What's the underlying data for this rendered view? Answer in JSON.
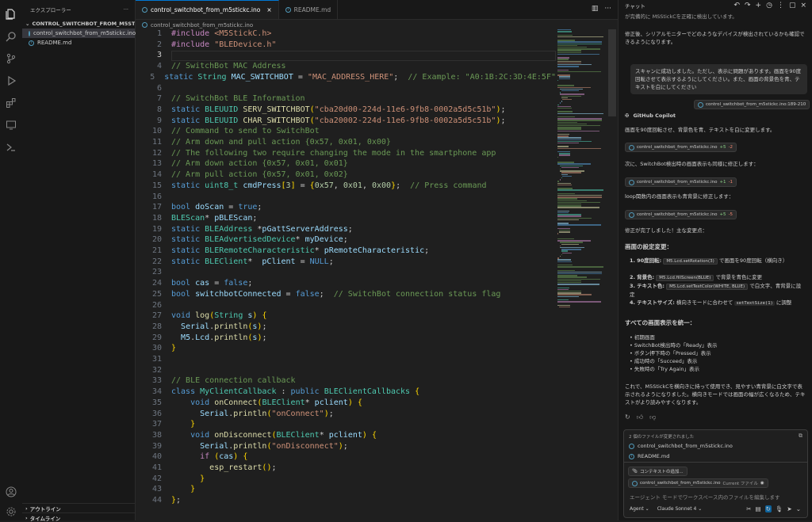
{
  "explorer": {
    "title": "エクスプローラー",
    "folder": "CONTROL_SWITCHBOT_FROM_M5STICKC_INO",
    "files": [
      "control_switchbot_from_m5stickc.ino",
      "README.md"
    ],
    "outline": "アウトライン",
    "timeline": "タイムライン"
  },
  "tabs": [
    {
      "label": "control_switchbot_from_m5stickc.ino",
      "active": true
    },
    {
      "label": "README.md",
      "active": false
    }
  ],
  "breadcrumb": "control_switchbot_from_m5stickc.ino",
  "code_lines": [
    "#include <M5StickC.h>",
    "#include \"BLEDevice.h\"",
    "",
    "// SwitchBot MAC Address",
    "static String MAC_SWITCHBOT = \"MAC_ADDRESS_HERE\";  // Example: \"A0:1B:2C:3D:4E:5F\"",
    "",
    "// SwitchBot BLE Information",
    "static BLEUUID SERV_SWITCHBOT(\"cba20d00-224d-11e6-9fb8-0002a5d5c51b\");",
    "static BLEUUID CHAR_SWITCHBOT(\"cba20002-224d-11e6-9fb8-0002a5d5c51b\");",
    "// Command to send to SwitchBot",
    "// Arm down and pull action {0x57, 0x01, 0x00}",
    "// The following two require changing the mode in the smartphone app",
    "// Arm down action {0x57, 0x01, 0x01}",
    "// Arm pull action {0x57, 0x01, 0x02}",
    "static uint8_t cmdPress[3] = {0x57, 0x01, 0x00};  // Press command",
    "",
    "bool doScan = true;",
    "BLEScan* pBLEScan;",
    "static BLEAddress *pGattServerAddress;",
    "static BLEAdvertisedDevice* myDevice;",
    "static BLERemoteCharacteristic* pRemoteCharacteristic;",
    "static BLEClient*  pClient = NULL;",
    "",
    "bool cas = false;",
    "bool switchbotConnected = false;  // SwitchBot connection status flag",
    "",
    "void log(String s) {",
    "  Serial.println(s);",
    "  M5.Lcd.println(s);",
    "}",
    "",
    "",
    "// BLE connection callback",
    "class MyClientCallback : public BLEClientCallbacks {",
    "    void onConnect(BLEClient* pclient) {",
    "      Serial.println(\"onConnect\");",
    "    }",
    "    void onDisconnect(BLEClient* pclient) {",
    "      Serial.println(\"onDisconnect\");",
    "      if (cas) {",
    "        esp_restart();",
    "      }",
    "    }",
    "};"
  ],
  "chat": {
    "title": "チャット",
    "top_text_1": "が完備的に MSStickCを正確に検出しています。",
    "top_text_2": "修正後、シリアルモニターでどのようなデバイスが検出されているかも確認できるようになります。",
    "user_msg": "スキャンに成功しました。ただし、表示に問題があります。画面を90度回転させて表示するようにしてください。また、画面の背景色を青、テキストを白にしてください",
    "user_ref": "control_switchbot_from_m5stickc.ino:189-210",
    "assistant": "GitHub Copilot",
    "p1": "画面を90度回転させ、背景色を青、テキストを白に変更します。",
    "edit1": {
      "file": "control_switchbot_from_m5stickc.ino",
      "plus": "+5",
      "minus": "-2"
    },
    "p2": "次に、SwitchBot検出時の画面表示も同様に修正します：",
    "edit2": {
      "file": "control_switchbot_from_m5stickc.ino",
      "plus": "+1",
      "minus": "-1"
    },
    "p3": "loop関数内の画面表示も青背景に修正します：",
    "edit3": {
      "file": "control_switchbot_from_m5stickc.ino",
      "plus": "+5",
      "minus": "-5"
    },
    "p4": "修正が完了しました！主な変更点：",
    "h1": "画面の設定変更：",
    "list1": [
      {
        "n": "1.",
        "b": "90度回転:",
        "code": "M5.Lcd.setRotation(3)",
        "rest": "で画面を90度回転（横向き）"
      },
      {
        "n": "2.",
        "b": "背景色:",
        "code": "M5.Lcd.fillScreen(BLUE)",
        "rest": "で背景を青色に変更"
      },
      {
        "n": "3.",
        "b": "テキスト色:",
        "code": "M5.Lcd.setTextColor(WHITE, BLUE)",
        "rest": "で白文字、青背景に設定"
      },
      {
        "n": "4.",
        "b": "テキストサイズ:",
        "code": "setTextSize(1)",
        "rest": "横向きモードに合わせて",
        "rest2": "に調整"
      }
    ],
    "h2": "すべての画面表示を統一：",
    "list2": [
      "初期画面",
      "SwitchBot検出時の「Ready」表示",
      "ボタン押下時の「Pressed」表示",
      "成功時の「Succeed」表示",
      "失敗時の「Try Again」表示"
    ],
    "p5": "これで、M5StickCを横向きに持って使用でき、見やすい青背景に白文字で表示されるようになりました。横向きモードでは画面の幅が広くなるため、テキストがより読みやすくなります。",
    "files_changed": "2 個のファイルが変更されました",
    "changed_files": [
      "control_switchbot_from_m5stickc.ino",
      "README.md"
    ],
    "add_context": "コンテキストの追加...",
    "current_file": "control_switchbot_from_m5stickc.ino",
    "current_file_tag": "Current ファイル",
    "placeholder": "エージェント モードでワークスペース内のファイルを編集します",
    "mode": "Agent",
    "model": "Claude Sonnet 4"
  }
}
